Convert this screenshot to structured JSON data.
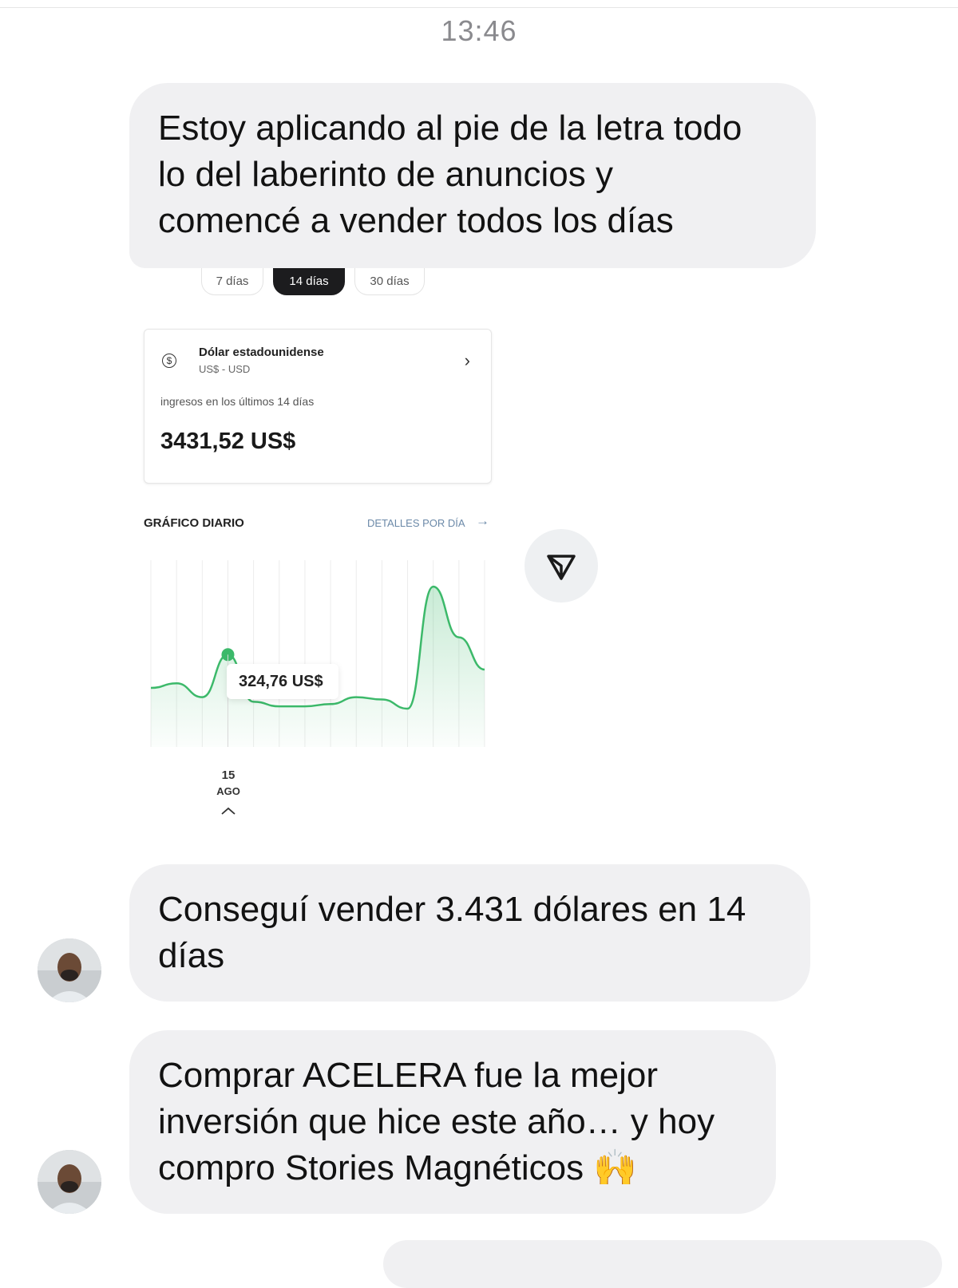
{
  "timestamp": "13:46",
  "messages": [
    {
      "text": "Estoy aplicando al pie de la letra todo\nlo del laberinto de anuncios y\ncomencé a vender todos los días"
    },
    {
      "text": "Conseguí vender 3.431 dólares en 14\ndías"
    },
    {
      "text": "Comprar ACELERA fue la mejor\ninversión que hice este año… y hoy\ncompro Stories Magnéticos 🙌"
    }
  ],
  "shared_image": {
    "range_pills": [
      "7 días",
      "14 días",
      "30 días"
    ],
    "selected_pill": "14 días",
    "card": {
      "currency_icon": "dollar-circle-icon",
      "currency_name": "Dólar estadounidense",
      "currency_code": "US$ - USD",
      "label": "ingresos en los últimos 14 días",
      "amount": "3431,52 US$"
    },
    "chart_header": "GRÁFICO DIARIO",
    "details_link": "DETALLES POR DÍA",
    "tooltip_value": "324,76 US$",
    "selected_date_day": "15",
    "selected_date_month": "AGO"
  },
  "chart_data": {
    "type": "area",
    "title": "GRÁFICO DIARIO",
    "series": [
      {
        "values": [
          180,
          200,
          140,
          324.76,
          120,
          100,
          100,
          110,
          140,
          130,
          90,
          620,
          400,
          260
        ]
      }
    ],
    "highlight": {
      "index": 3,
      "label": "324,76 US$",
      "date": "15 AGO"
    },
    "color": "#3cb96a",
    "ylim": [
      0,
      700
    ],
    "grid": "vertical"
  },
  "colors": {
    "bubble": "#f0f0f2",
    "accent_green": "#3cb96a",
    "pill_active": "#1c1c1e"
  }
}
